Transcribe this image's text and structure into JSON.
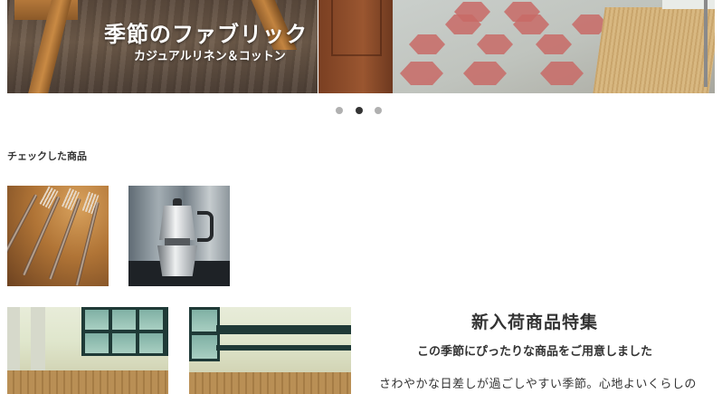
{
  "carousel": {
    "slide1_title": "季節のファブリック",
    "slide1_subtitle": "カジュアルリネン＆コットン",
    "dots": 3,
    "active_dot": 2
  },
  "checked_products": {
    "heading": "チェックした商品",
    "items": [
      {
        "icon": "forks-photo"
      },
      {
        "icon": "coffee-maker-photo"
      }
    ]
  },
  "feature": {
    "title": "新入荷商品特集",
    "subtitle": "この季節にぴったりな商品をご用意しました",
    "body": "さわやかな日差しが過ごしやすい季節。心地よいくらしの"
  },
  "colors": {
    "dot_inactive": "#b0b0b0",
    "dot_active": "#333333",
    "text": "#333333"
  }
}
